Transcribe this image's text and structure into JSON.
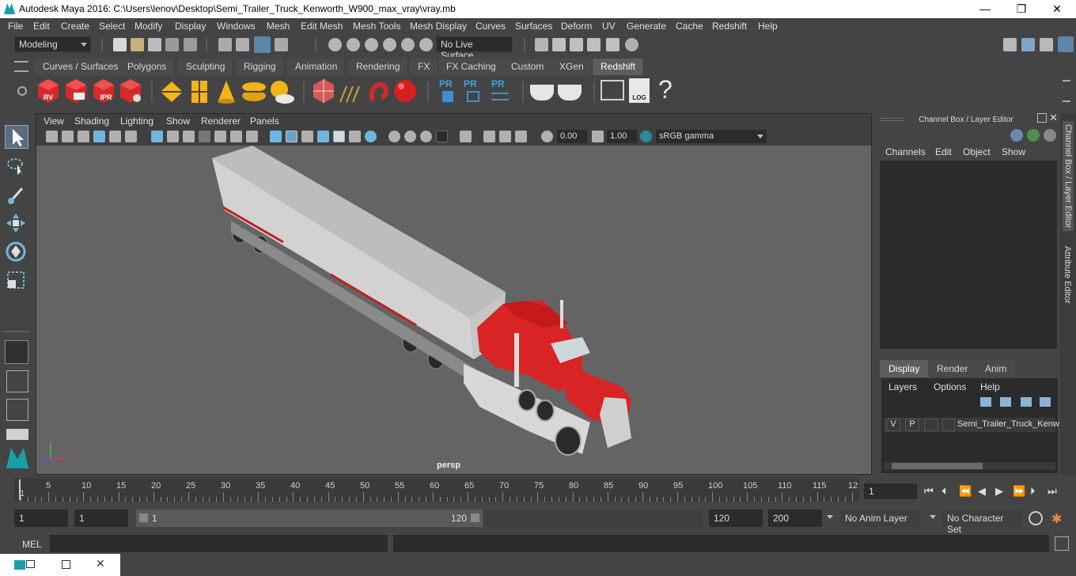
{
  "window": {
    "title": "Autodesk Maya 2016: C:\\Users\\lenov\\Desktop\\Semi_Trailer_Truck_Kenworth_W900_max_vray\\vray.mb",
    "minimize": "—",
    "maximize": "❐",
    "close": "✕"
  },
  "menubar": [
    "File",
    "Edit",
    "Create",
    "Select",
    "Modify",
    "Display",
    "Windows",
    "Mesh",
    "Edit Mesh",
    "Mesh Tools",
    "Mesh Display",
    "Curves",
    "Surfaces",
    "Deform",
    "UV",
    "Generate",
    "Cache",
    "Redshift",
    "Help"
  ],
  "statusline": {
    "mode": "Modeling",
    "live_surface": "No Live Surface"
  },
  "shelf_tabs": [
    "Curves / Surfaces",
    "Polygons",
    "Sculpting",
    "Rigging",
    "Animation",
    "Rendering",
    "FX",
    "FX Caching",
    "Custom",
    "XGen",
    "Redshift"
  ],
  "shelf_active": "Redshift",
  "shelf_labels": {
    "rv": "RV",
    "ipr": "IPR",
    "pr1": "PR",
    "pr2": "PR",
    "pr3": "PR",
    "log": "LOG",
    "help": "?"
  },
  "viewport": {
    "menu": [
      "View",
      "Shading",
      "Lighting",
      "Show",
      "Renderer",
      "Panels"
    ],
    "exposure": "0.00",
    "gamma": "1.00",
    "color_space": "sRGB gamma",
    "camera_label": "persp"
  },
  "channel_box": {
    "title": "Channel Box / Layer Editor",
    "menu": [
      "Channels",
      "Edit",
      "Object",
      "Show"
    ],
    "tabs": [
      "Display",
      "Render",
      "Anim"
    ],
    "active_tab": "Display",
    "layer_menu": [
      "Layers",
      "Options",
      "Help"
    ],
    "layer": {
      "v": "V",
      "p": "P",
      "name": "Semi_Trailer_Truck_Kenw"
    }
  },
  "side_tabs": [
    "Channel Box / Layer Editor",
    "Attribute Editor"
  ],
  "timeline": {
    "ticks": [
      "1",
      "5",
      "10",
      "15",
      "20",
      "25",
      "30",
      "35",
      "40",
      "45",
      "50",
      "55",
      "60",
      "65",
      "70",
      "75",
      "80",
      "85",
      "90",
      "95",
      "100",
      "105",
      "110",
      "115",
      "12"
    ],
    "current_frame": "1"
  },
  "range": {
    "start": "1",
    "playback_start": "1",
    "slider_start": "1",
    "slider_end": "120",
    "playback_end": "120",
    "end": "200",
    "anim_layer": "No Anim Layer",
    "character_set": "No Character Set"
  },
  "command_line": {
    "label": "MEL"
  },
  "colors": {
    "accent": "#5fa8d3",
    "truck_red": "#d32020",
    "trailer": "#c8c8c8"
  }
}
